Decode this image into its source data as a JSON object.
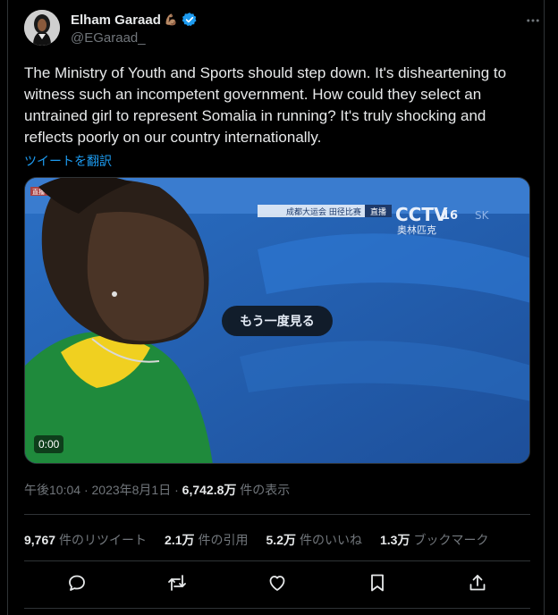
{
  "author": {
    "display_name": "Elham Garaad",
    "emoji": "💪🏽",
    "handle": "@EGaraad_",
    "verified": true
  },
  "tweet": {
    "text": "The Ministry of Youth and Sports should step down. It's disheartening to witness such an incompetent government. How could they select an untrained girl to represent Somalia in running? It's truly shocking and reflects poorly on our country internationally.",
    "translate_label": "ツイートを翻訳"
  },
  "media": {
    "replay_label": "もう一度見る",
    "time": "0:00",
    "broadcast_banner": "成都大运会 田径比赛",
    "live_label": "直播",
    "channel_logo": "CCTV",
    "channel_number": "16",
    "olympic_text": "奥林匹克",
    "sk_text": "SK",
    "corner_tag": "直播中"
  },
  "meta": {
    "time": "午後10:04",
    "date": "2023年8月1日",
    "separator": "·",
    "views_count": "6,742.8万",
    "views_label": "件の表示"
  },
  "stats": [
    {
      "count": "9,767",
      "label": "件のリツイート"
    },
    {
      "count": "2.1万",
      "label": "件の引用"
    },
    {
      "count": "5.2万",
      "label": "件のいいね"
    },
    {
      "count": "1.3万",
      "label": "ブックマーク"
    }
  ],
  "colors": {
    "background": "#000000",
    "text": "#e7e9ea",
    "muted": "#71767b",
    "link": "#1d9bf0",
    "verified": "#1d9bf0",
    "divider": "#2f3336"
  },
  "icons": [
    "reply-icon",
    "retweet-icon",
    "like-icon",
    "bookmark-icon",
    "share-icon"
  ]
}
